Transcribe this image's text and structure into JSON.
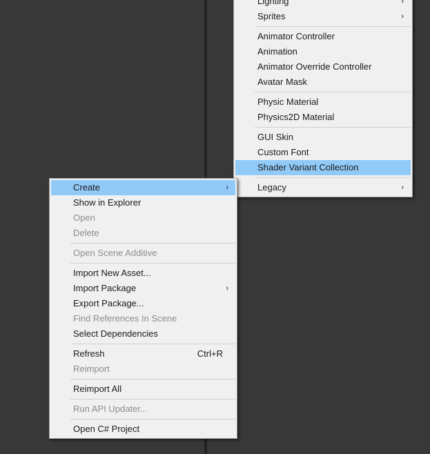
{
  "create_submenu": {
    "items": [
      {
        "label": "Lighting",
        "type": "item",
        "arrow": "›"
      },
      {
        "label": "Sprites",
        "type": "item",
        "arrow": "›"
      },
      {
        "type": "separator"
      },
      {
        "label": "Animator Controller",
        "type": "item"
      },
      {
        "label": "Animation",
        "type": "item"
      },
      {
        "label": "Animator Override Controller",
        "type": "item"
      },
      {
        "label": "Avatar Mask",
        "type": "item"
      },
      {
        "type": "separator"
      },
      {
        "label": "Physic Material",
        "type": "item"
      },
      {
        "label": "Physics2D Material",
        "type": "item"
      },
      {
        "type": "separator"
      },
      {
        "label": "GUI Skin",
        "type": "item"
      },
      {
        "label": "Custom Font",
        "type": "item"
      },
      {
        "label": "Shader Variant Collection",
        "type": "item",
        "highlighted": true
      },
      {
        "type": "separator"
      },
      {
        "label": "Legacy",
        "type": "item",
        "arrow": "›"
      }
    ]
  },
  "context_menu": {
    "items": [
      {
        "label": "Create",
        "type": "item",
        "arrow": "›",
        "highlighted": true
      },
      {
        "label": "Show in Explorer",
        "type": "item"
      },
      {
        "label": "Open",
        "type": "item",
        "disabled": true
      },
      {
        "label": "Delete",
        "type": "item",
        "disabled": true
      },
      {
        "type": "separator"
      },
      {
        "label": "Open Scene Additive",
        "type": "item",
        "disabled": true
      },
      {
        "type": "separator"
      },
      {
        "label": "Import New Asset...",
        "type": "item"
      },
      {
        "label": "Import Package",
        "type": "item",
        "arrow": "›"
      },
      {
        "label": "Export Package...",
        "type": "item"
      },
      {
        "label": "Find References In Scene",
        "type": "item",
        "disabled": true
      },
      {
        "label": "Select Dependencies",
        "type": "item"
      },
      {
        "type": "separator"
      },
      {
        "label": "Refresh",
        "type": "item",
        "shortcut": "Ctrl+R"
      },
      {
        "label": "Reimport",
        "type": "item",
        "disabled": true
      },
      {
        "type": "separator"
      },
      {
        "label": "Reimport All",
        "type": "item"
      },
      {
        "type": "separator"
      },
      {
        "label": "Run API Updater...",
        "type": "item",
        "disabled": true
      },
      {
        "type": "separator"
      },
      {
        "label": "Open C# Project",
        "type": "item"
      }
    ]
  },
  "colors": {
    "highlight": "#91c9f7",
    "menu_background": "#f0f0f0",
    "editor_background": "#383838",
    "disabled_text": "#8c8c8c"
  }
}
